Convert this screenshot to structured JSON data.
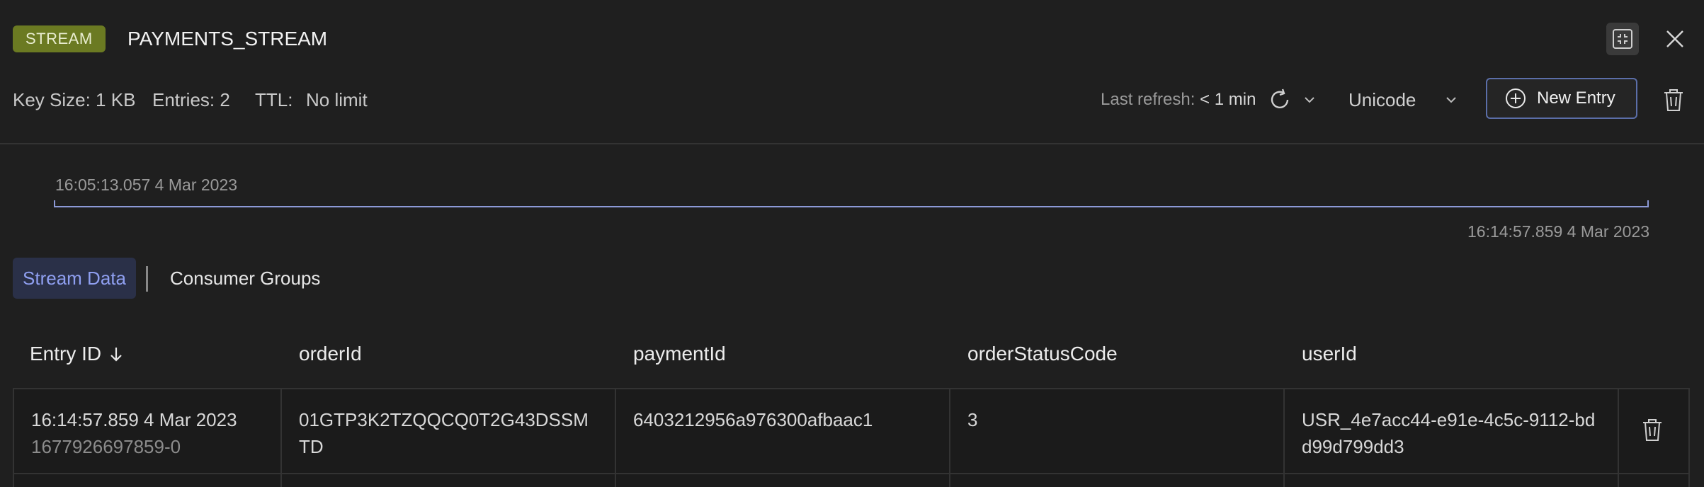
{
  "header": {
    "type_badge": "STREAM",
    "key_name": "PAYMENTS_STREAM"
  },
  "meta": {
    "key_size": "Key Size: 1 KB",
    "entries": "Entries: 2",
    "ttl_label": "TTL:",
    "ttl_value": "No limit"
  },
  "toolbar": {
    "last_refresh_label": "Last refresh:",
    "last_refresh_value": "< 1 min",
    "format": "Unicode",
    "new_entry_label": "New Entry"
  },
  "timeline": {
    "start": "16:05:13.057 4 Mar 2023",
    "end": "16:14:57.859 4 Mar 2023"
  },
  "tabs": [
    {
      "label": "Stream Data",
      "active": true
    },
    {
      "label": "Consumer Groups",
      "active": false
    }
  ],
  "table": {
    "columns": [
      "Entry ID",
      "orderId",
      "paymentId",
      "orderStatusCode",
      "userId"
    ],
    "rows": [
      {
        "timestamp": "16:14:57.859 4 Mar 2023",
        "entry_id": "1677926697859-0",
        "orderId": "01GTP3K2TZQQCQ0T2G43DSSMTD",
        "paymentId": "6403212956a976300afbaac1",
        "orderStatusCode": "3",
        "userId": "USR_4e7acc44-e91e-4c5c-9112-bdd99d799dd3"
      }
    ]
  },
  "colors": {
    "badge": "#6b7a22",
    "accent": "#8c99d6",
    "active_tab_bg": "#2a3048",
    "background": "#1f1f1f"
  },
  "icons": [
    "fullscreen-exit-icon",
    "close-icon",
    "refresh-icon",
    "chevron-down-icon",
    "plus-circle-icon",
    "trash-icon",
    "arrow-down-icon"
  ]
}
